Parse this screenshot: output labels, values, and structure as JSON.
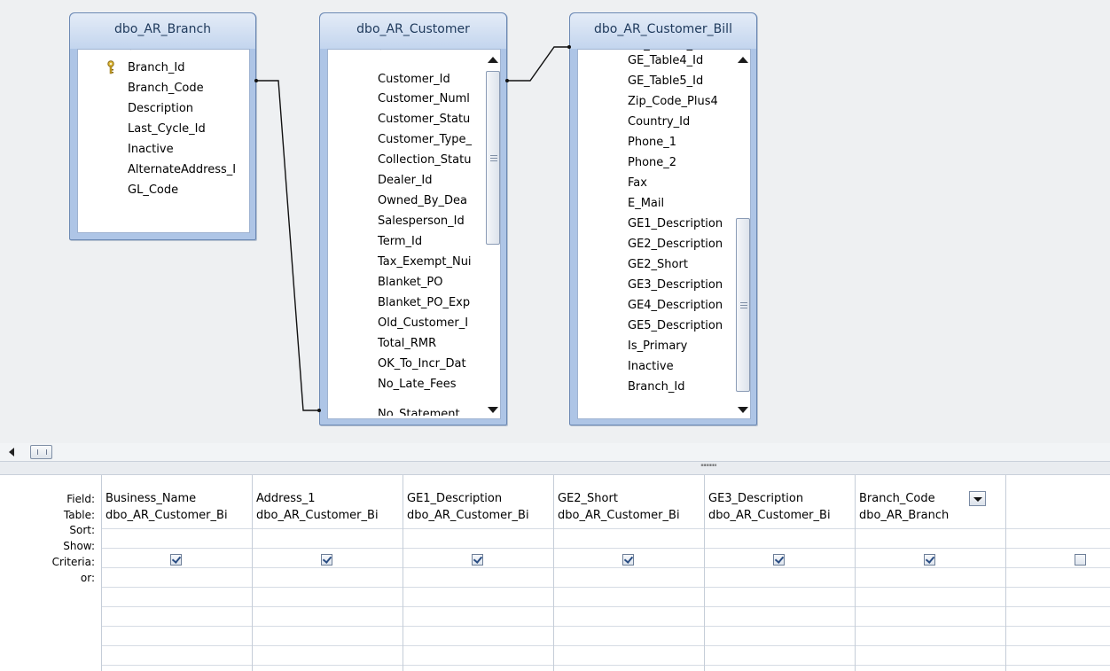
{
  "tables": {
    "branch": {
      "title": "dbo_AR_Branch",
      "fields": [
        "*",
        "Branch_Id",
        "Branch_Code",
        "Description",
        "Last_Cycle_Id",
        "Inactive",
        "AlternateAddress_I",
        "GL_Code"
      ]
    },
    "customer": {
      "title": "dbo_AR_Customer",
      "fields": [
        "*",
        "Customer_Id",
        "Customer_Numl",
        "Customer_Statu",
        "Customer_Type_",
        "Collection_Statu",
        "Dealer_Id",
        "Owned_By_Dea",
        "Salesperson_Id",
        "Term_Id",
        "Tax_Exempt_Nui",
        "Blanket_PO",
        "Blanket_PO_Exp",
        "Old_Customer_I",
        "Total_RMR",
        "OK_To_Incr_Dat",
        "No_Late_Fees"
      ]
    },
    "bill": {
      "title": "dbo_AR_Customer_Bill",
      "fields": [
        "GE_Table4_Id",
        "GE_Table5_Id",
        "Zip_Code_Plus4",
        "Country_Id",
        "Phone_1",
        "Phone_2",
        "Fax",
        "E_Mail",
        "GE1_Description",
        "GE2_Description",
        "GE2_Short",
        "GE3_Description",
        "GE4_Description",
        "GE5_Description",
        "Is_Primary",
        "Inactive",
        "Branch_Id"
      ]
    }
  },
  "grid": {
    "row_labels": [
      "Field:",
      "Table:",
      "Sort:",
      "Show:",
      "Criteria:",
      "or:"
    ],
    "columns": [
      {
        "field": "Business_Name",
        "table": "dbo_AR_Customer_Bi",
        "show": true
      },
      {
        "field": "Address_1",
        "table": "dbo_AR_Customer_Bi",
        "show": true
      },
      {
        "field": "GE1_Description",
        "table": "dbo_AR_Customer_Bi",
        "show": true
      },
      {
        "field": "GE2_Short",
        "table": "dbo_AR_Customer_Bi",
        "show": true
      },
      {
        "field": "GE3_Description",
        "table": "dbo_AR_Customer_Bi",
        "show": true
      },
      {
        "field": "Branch_Code",
        "table": "dbo_AR_Branch",
        "show": true
      },
      {
        "field": "",
        "table": "",
        "show": false
      }
    ]
  },
  "icons": {
    "primary_key": "key-icon",
    "field_dropdown": "chevron-down-icon",
    "scroll_left": "arrow-left-icon",
    "scroll_up": "arrow-up-icon",
    "scroll_down": "arrow-down-icon"
  },
  "colors": {
    "table_frame": "#aec5e6",
    "table_border": "#6b88b3",
    "title_text": "#1e395b",
    "check": "#2a4d83",
    "key": "#c9a227"
  }
}
